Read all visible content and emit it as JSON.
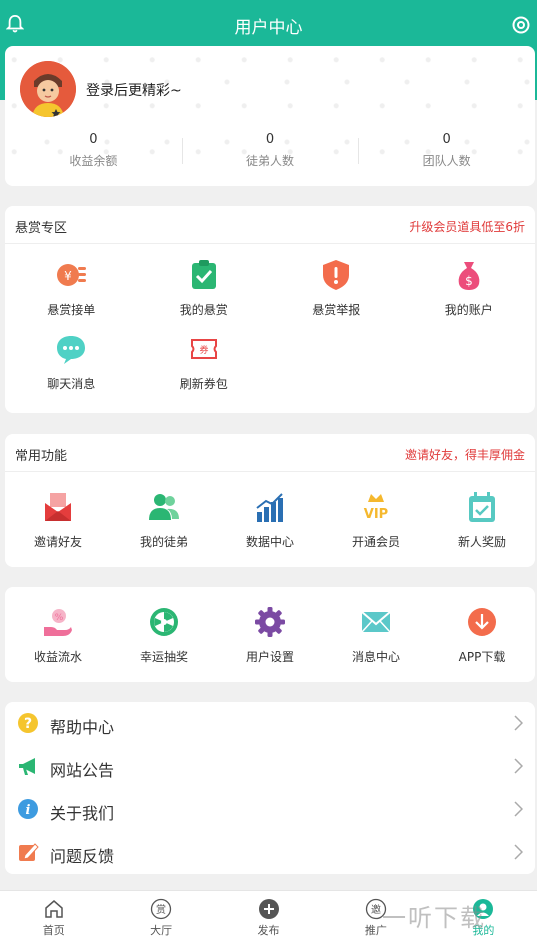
{
  "header": {
    "title": "用户中心",
    "left_icon": "bell-icon",
    "right_icon": "settings-icon"
  },
  "profile": {
    "login_prompt": "登录后更精彩~",
    "stats": [
      {
        "value": "0",
        "label": "收益余额"
      },
      {
        "value": "0",
        "label": "徒弟人数"
      },
      {
        "value": "0",
        "label": "团队人数"
      }
    ]
  },
  "bounty": {
    "title": "悬赏专区",
    "promo": "升级会员道具低至6折",
    "items": [
      {
        "label": "悬赏接单",
        "icon": "coins-icon",
        "color": "#f07b4f"
      },
      {
        "label": "我的悬赏",
        "icon": "clipboard-check-icon",
        "color": "#2bb673"
      },
      {
        "label": "悬赏举报",
        "icon": "shield-alert-icon",
        "color": "#f36c4c"
      },
      {
        "label": "我的账户",
        "icon": "money-bag-icon",
        "color": "#ec4d7b"
      },
      {
        "label": "聊天消息",
        "icon": "chat-bubble-icon",
        "color": "#4fd1c5"
      },
      {
        "label": "刷新券包",
        "icon": "ticket-icon",
        "color": "#e84545"
      }
    ]
  },
  "common": {
    "title": "常用功能",
    "promo": "邀请好友，得丰厚佣金",
    "items": [
      {
        "label": "邀请好友",
        "icon": "invite-envelope-icon",
        "color": "#e43d3d"
      },
      {
        "label": "我的徒弟",
        "icon": "users-icon",
        "color": "#2bb673"
      },
      {
        "label": "数据中心",
        "icon": "bar-chart-icon",
        "color": "#2a6fb3"
      },
      {
        "label": "开通会员",
        "icon": "vip-crown-icon",
        "color": "#f5b82e"
      },
      {
        "label": "新人奖励",
        "icon": "calendar-check-icon",
        "color": "#57c9c2"
      }
    ]
  },
  "more": {
    "items": [
      {
        "label": "收益流水",
        "icon": "hand-coin-icon",
        "color": "#ef6f9a"
      },
      {
        "label": "幸运抽奖",
        "icon": "lucky-wheel-icon",
        "color": "#2bb673"
      },
      {
        "label": "用户设置",
        "icon": "gear-icon",
        "color": "#7b4aa3"
      },
      {
        "label": "消息中心",
        "icon": "mail-icon",
        "color": "#5bc8c9"
      },
      {
        "label": "APP下载",
        "icon": "download-icon",
        "color": "#f36c4c"
      }
    ]
  },
  "list": {
    "items": [
      {
        "label": "帮助中心",
        "icon": "question-icon",
        "color": "#f5c52e"
      },
      {
        "label": "网站公告",
        "icon": "megaphone-icon",
        "color": "#2bb673"
      },
      {
        "label": "关于我们",
        "icon": "info-icon",
        "color": "#3d9be0"
      },
      {
        "label": "问题反馈",
        "icon": "edit-icon",
        "color": "#f07b4f"
      }
    ]
  },
  "tabbar": {
    "items": [
      {
        "label": "首页",
        "icon": "home-icon"
      },
      {
        "label": "大厅",
        "icon": "reward-icon",
        "glyph": "赏"
      },
      {
        "label": "发布",
        "icon": "plus-circle-icon"
      },
      {
        "label": "推广",
        "icon": "invite-icon",
        "glyph": "邀"
      },
      {
        "label": "我的",
        "icon": "user-icon",
        "active": true
      }
    ],
    "active_color": "#1bb898"
  },
  "watermark": "一听下载",
  "theme": {
    "primary": "#1bb898",
    "accent_red": "#e03a3a"
  }
}
